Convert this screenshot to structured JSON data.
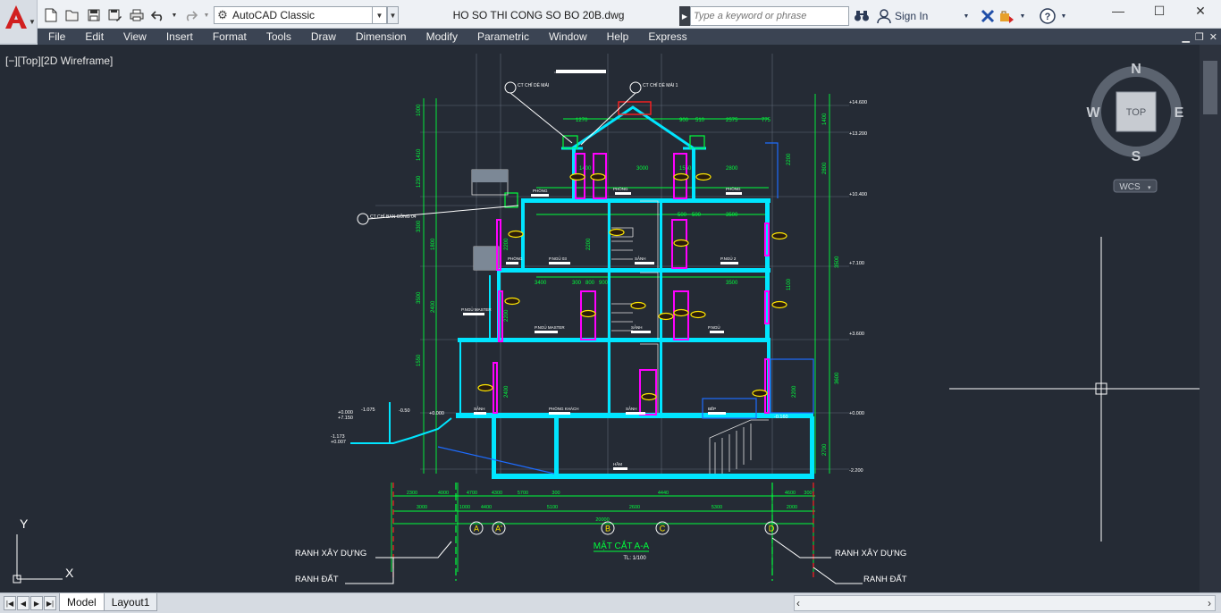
{
  "titlebar": {
    "document_title": "HO SO THI CONG SO BO 20B.dwg",
    "workspace": "AutoCAD Classic",
    "search_placeholder": "Type a keyword or phrase",
    "sign_in": "Sign In"
  },
  "menu": [
    "File",
    "Edit",
    "View",
    "Insert",
    "Format",
    "Tools",
    "Draw",
    "Dimension",
    "Modify",
    "Parametric",
    "Window",
    "Help",
    "Express"
  ],
  "viewport": {
    "label": "[−][Top][2D Wireframe]",
    "viewcube": {
      "north": "N",
      "south": "S",
      "east": "E",
      "west": "W",
      "face": "TOP",
      "ucs": "WCS"
    },
    "ucs_axes": {
      "y": "Y",
      "x": "X"
    }
  },
  "drawing": {
    "section_title": "MẶT CẮT A-A",
    "scale": "TL: 1/100",
    "boundary_labels": {
      "left_build": "RANH XÂY DỰNG",
      "left_land": "RANH ĐẤT",
      "right_build": "RANH XÂY DỰNG",
      "right_land": "RANH ĐẤT"
    },
    "grid_axes": [
      "A",
      "A'",
      "B",
      "C",
      "D"
    ],
    "level_marks": [
      "+14.600",
      "+13.200",
      "+10.400",
      "+7.100",
      "+3.600",
      "+0.000",
      "-2.200"
    ],
    "callouts": [
      "CT CHỈ DÈ MÁI",
      "CT CHỈ DÈ MÁI 1",
      "CT CHỈ BAN CÔNG 04"
    ],
    "dim_row1": [
      "2300",
      "4000",
      "4700",
      "4300",
      "5700",
      "300",
      "4440",
      "4600",
      "300"
    ],
    "dim_row2": [
      "3000",
      "1000",
      "4400",
      "5100",
      "2600",
      "5300",
      "2000"
    ],
    "dim_total": "20000"
  },
  "layout_tabs": [
    "Model",
    "Layout1"
  ],
  "colors": {
    "canvas": "#252b35",
    "wall": "#00e5ff",
    "dim": "#00ff3c",
    "door": "#ff00ff",
    "boundary": "#ff2020",
    "menubar": "#3b4453"
  }
}
